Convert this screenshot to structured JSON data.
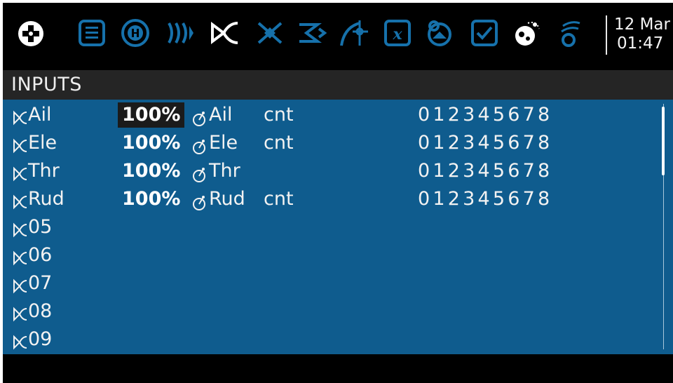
{
  "header": {
    "clock_date": "12 Mar",
    "clock_time": "01:47",
    "icons": [
      "radio-menu-icon",
      "model-notes-icon",
      "heli-icon",
      "flight-modes-icon",
      "inputs-icon",
      "mixes-icon",
      "outputs-icon",
      "curves-icon",
      "logical-switches-icon",
      "global-variables-icon",
      "special-functions-icon",
      "telemetry-icon",
      "checklist-icon",
      "screens-icon",
      "sound-icon"
    ]
  },
  "colors": {
    "toolbar_icon": "#1671ab",
    "toolbar_icon_active": "#ffffff",
    "list_background": "#0f5c8e",
    "header_background": "#252525"
  },
  "page": {
    "title": "INPUTS"
  },
  "inputs": [
    {
      "name": "Ail",
      "weight": "100%",
      "source": "Ail",
      "curve": "cnt",
      "switches": "012345678",
      "selected": true
    },
    {
      "name": "Ele",
      "weight": "100%",
      "source": "Ele",
      "curve": "cnt",
      "switches": "012345678"
    },
    {
      "name": "Thr",
      "weight": "100%",
      "source": "Thr",
      "curve": "",
      "switches": "012345678"
    },
    {
      "name": "Rud",
      "weight": "100%",
      "source": "Rud",
      "curve": "cnt",
      "switches": "012345678"
    },
    {
      "name": "05"
    },
    {
      "name": "06"
    },
    {
      "name": "07"
    },
    {
      "name": "08"
    },
    {
      "name": "09"
    }
  ]
}
